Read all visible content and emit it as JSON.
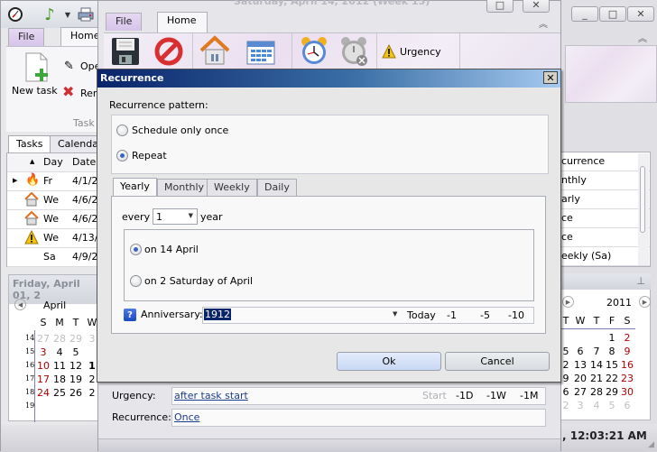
{
  "back_window": {
    "quick_access": [
      "clock-icon",
      "music-note-icon",
      "printer-icon"
    ],
    "tabs": [
      {
        "label": "File"
      },
      {
        "label": "Home"
      }
    ],
    "ribbon": {
      "new_task": "New task",
      "open": "Ope",
      "remove": "Rer",
      "group_label": "Task"
    },
    "view_tabs": [
      {
        "label": "Tasks"
      },
      {
        "label": "Calendar"
      }
    ],
    "grid": {
      "headers": [
        "",
        "▲",
        "Day",
        "Date"
      ],
      "rows": [
        {
          "icon": "fire-icon",
          "day": "Fr",
          "date": "4/1/2",
          "selected": true
        },
        {
          "icon": "home-icon",
          "day": "We",
          "date": "4/6/2",
          "selected": false
        },
        {
          "icon": "home-icon",
          "day": "We",
          "date": "4/6/2",
          "selected": false
        },
        {
          "icon": "warning-icon",
          "day": "We",
          "date": "4/13/",
          "selected": false
        },
        {
          "icon": "",
          "day": "Sa",
          "date": "4/9/2",
          "selected": false
        }
      ]
    },
    "calendar": {
      "header": "Friday, April 01, 2",
      "month": "April",
      "weekday_headers": [
        "S",
        "M",
        "T",
        "W"
      ],
      "week_numbers": [
        "14",
        "15",
        "16",
        "17",
        "18",
        "19"
      ],
      "weeks": [
        [
          "27",
          "28",
          "29",
          "3"
        ],
        [
          "3",
          "4",
          "5",
          ""
        ],
        [
          "10",
          "11",
          "12",
          "1"
        ],
        [
          "17",
          "18",
          "19",
          "2"
        ],
        [
          "24",
          "25",
          "26",
          "2"
        ],
        [
          "",
          "",
          "",
          ""
        ]
      ]
    }
  },
  "middle_window": {
    "title": "Saturday, April 14, 2012 (Week 15)",
    "tabs": [
      {
        "label": "File"
      },
      {
        "label": "Home"
      }
    ],
    "ribbon_icons": [
      "save-icon",
      "cancel-icon",
      "home-icon",
      "calendar-icon",
      "alarm-clock-icon",
      "alarm-off-icon"
    ],
    "urgency_button": "Urgency",
    "fields": {
      "urgency_label": "Urgency:",
      "urgency_value": "after task start",
      "urgency_shortcuts": [
        "Start",
        "-1D",
        "-1W",
        "-1M"
      ],
      "recurrence_label": "Recurrence:",
      "recurrence_value": "Once"
    }
  },
  "right_window": {
    "grid_header": "currence",
    "grid_rows": [
      "nthly",
      "arly",
      "ce",
      "ce",
      "eekly (Sa)"
    ],
    "calendar": {
      "year": "2011",
      "weekday_headers": [
        "T",
        "W",
        "T",
        "F",
        "S"
      ],
      "weeks": [
        [
          "",
          "",
          "",
          "1",
          "2"
        ],
        [
          "5",
          "6",
          "7",
          "8",
          "9"
        ],
        [
          "2",
          "13",
          "14",
          "15",
          "16"
        ],
        [
          "9",
          "20",
          "21",
          "22",
          "23"
        ],
        [
          "6",
          "27",
          "28",
          "29",
          "30"
        ],
        [
          "2",
          "3",
          "4",
          "5",
          "6"
        ]
      ]
    },
    "status_time": ", 12:03:21 AM"
  },
  "dialog": {
    "title": "Recurrence",
    "pattern_label": "Recurrence pattern:",
    "options": [
      {
        "label": "Schedule only once",
        "selected": false
      },
      {
        "label": "Repeat",
        "selected": true
      }
    ],
    "tabs": [
      {
        "label": "Yearly",
        "active": true
      },
      {
        "label": "Monthly",
        "active": false
      },
      {
        "label": "Weekly",
        "active": false
      },
      {
        "label": "Daily",
        "active": false
      }
    ],
    "every_label": "every",
    "every_value": "1",
    "year_label": "year",
    "yearly_options": [
      {
        "label": "on 14 April",
        "selected": true
      },
      {
        "label": "on 2 Saturday of April",
        "selected": false
      }
    ],
    "anniversary_label": "Anniversary:",
    "anniversary_value": "1912",
    "anniversary_shortcuts": [
      "Today",
      "-1",
      "-5",
      "-10"
    ],
    "ok": "Ok",
    "cancel": "Cancel"
  }
}
